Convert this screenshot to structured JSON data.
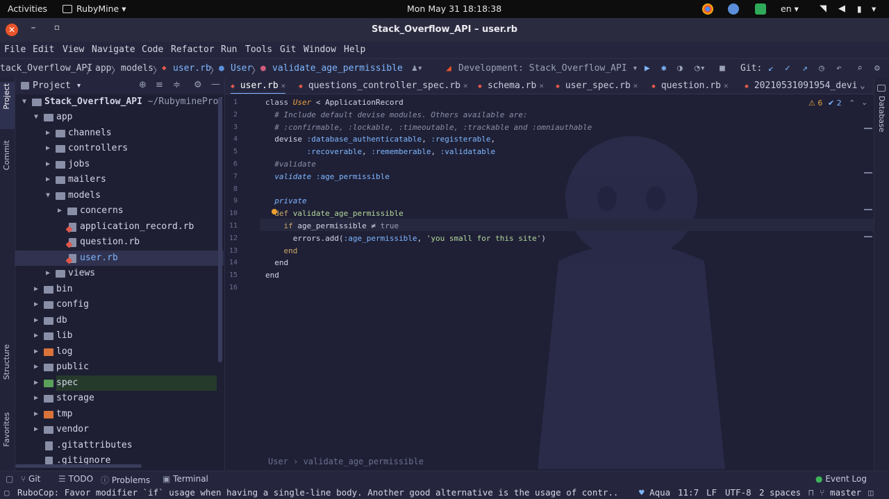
{
  "system": {
    "activities": "Activities",
    "app_menu": "RubyMine",
    "clock": "Mon May 31  18:18:38",
    "lang": "en"
  },
  "window": {
    "title": "Stack_Overflow_API – user.rb",
    "close_glyph": "✕",
    "min_glyph": "–",
    "max_glyph": "▫"
  },
  "menu": [
    "File",
    "Edit",
    "View",
    "Navigate",
    "Code",
    "Refactor",
    "Run",
    "Tools",
    "Git",
    "Window",
    "Help"
  ],
  "nav": {
    "project": "tack_Overflow_API",
    "sep": "〉",
    "app": "app",
    "models": "models",
    "file": "user.rb",
    "class": "User",
    "method": "validate_age_permissible",
    "run_config": "Development: Stack_Overflow_API",
    "git_label": "Git:"
  },
  "left_tabs": {
    "project": "Project",
    "commit": "Commit",
    "structure": "Structure",
    "favorites": "Favorites"
  },
  "right_tabs": {
    "database": "Database"
  },
  "project_panel": {
    "title": "Project",
    "root_name": "Stack_Overflow_API",
    "root_path": "~/RubymineProjec",
    "tree": [
      {
        "label": "app",
        "depth": 1,
        "open": true,
        "kind": "folder"
      },
      {
        "label": "channels",
        "depth": 2,
        "open": false,
        "kind": "folder"
      },
      {
        "label": "controllers",
        "depth": 2,
        "open": false,
        "kind": "folder"
      },
      {
        "label": "jobs",
        "depth": 2,
        "open": false,
        "kind": "folder"
      },
      {
        "label": "mailers",
        "depth": 2,
        "open": false,
        "kind": "folder"
      },
      {
        "label": "models",
        "depth": 2,
        "open": true,
        "kind": "folder"
      },
      {
        "label": "concerns",
        "depth": 3,
        "open": false,
        "kind": "folder"
      },
      {
        "label": "application_record.rb",
        "depth": 3,
        "kind": "ruby"
      },
      {
        "label": "question.rb",
        "depth": 3,
        "kind": "ruby"
      },
      {
        "label": "user.rb",
        "depth": 3,
        "kind": "ruby",
        "selected": true
      },
      {
        "label": "views",
        "depth": 2,
        "open": false,
        "kind": "folder"
      },
      {
        "label": "bin",
        "depth": 1,
        "open": false,
        "kind": "folder"
      },
      {
        "label": "config",
        "depth": 1,
        "open": false,
        "kind": "folder"
      },
      {
        "label": "db",
        "depth": 1,
        "open": false,
        "kind": "folder"
      },
      {
        "label": "lib",
        "depth": 1,
        "open": false,
        "kind": "folder"
      },
      {
        "label": "log",
        "depth": 1,
        "open": false,
        "kind": "folder-orange"
      },
      {
        "label": "public",
        "depth": 1,
        "open": false,
        "kind": "folder"
      },
      {
        "label": "spec",
        "depth": 1,
        "open": false,
        "kind": "folder-green"
      },
      {
        "label": "storage",
        "depth": 1,
        "open": false,
        "kind": "folder"
      },
      {
        "label": "tmp",
        "depth": 1,
        "open": false,
        "kind": "folder-orange"
      },
      {
        "label": "vendor",
        "depth": 1,
        "open": false,
        "kind": "folder"
      },
      {
        "label": ".gitattributes",
        "depth": 1,
        "kind": "file"
      },
      {
        "label": ".gitignore",
        "depth": 1,
        "kind": "file"
      }
    ]
  },
  "tabs": [
    {
      "label": "user.rb",
      "active": true
    },
    {
      "label": "questions_controller_spec.rb",
      "active": false
    },
    {
      "label": "schema.rb",
      "active": false
    },
    {
      "label": "user_spec.rb",
      "active": false
    },
    {
      "label": "question.rb",
      "active": false
    },
    {
      "label": "20210531091954_devi",
      "active": false
    }
  ],
  "inspections": {
    "warnings": "6",
    "weak": "2"
  },
  "code_lines": [
    [
      {
        "t": "class",
        "c": "kw2"
      },
      {
        "t": " "
      },
      {
        "t": "User",
        "c": "cls"
      },
      {
        "t": " < ApplicationRecord"
      }
    ],
    [
      {
        "t": "  # Include default devise modules. Others available are:",
        "c": "cmt"
      }
    ],
    [
      {
        "t": "  # :confirmable, :lockable, :timeoutable, :trackable and :omniauthable",
        "c": "cmt"
      }
    ],
    [
      {
        "t": "  devise "
      },
      {
        "t": ":database_authenticatable",
        "c": "sym"
      },
      {
        "t": ", "
      },
      {
        "t": ":registerable",
        "c": "sym"
      },
      {
        "t": ","
      }
    ],
    [
      {
        "t": "         "
      },
      {
        "t": ":recoverable",
        "c": "sym"
      },
      {
        "t": ", "
      },
      {
        "t": ":rememberable",
        "c": "sym"
      },
      {
        "t": ", "
      },
      {
        "t": ":validatable",
        "c": "sym"
      }
    ],
    [
      {
        "t": "  #validate",
        "c": "cmt"
      }
    ],
    [
      {
        "t": "  "
      },
      {
        "t": "validate",
        "c": "valid"
      },
      {
        "t": " "
      },
      {
        "t": ":age_permissible",
        "c": "sym"
      }
    ],
    [
      {
        "t": ""
      }
    ],
    [
      {
        "t": "  "
      },
      {
        "t": "private",
        "c": "valid"
      }
    ],
    [
      {
        "t": "  "
      },
      {
        "t": "def",
        "c": "kw"
      },
      {
        "t": " validate_age_permissible",
        "c": "str"
      }
    ],
    [
      {
        "t": "    "
      },
      {
        "t": "if",
        "c": "kw"
      },
      {
        "t": " age_permissible ≠ "
      },
      {
        "t": "true",
        "c": "muted"
      }
    ],
    [
      {
        "t": "      errors.add("
      },
      {
        "t": ":age_permissible",
        "c": "sym"
      },
      {
        "t": ", "
      },
      {
        "t": "'you small for this site'",
        "c": "str"
      },
      {
        "t": ")"
      }
    ],
    [
      {
        "t": "    "
      },
      {
        "t": "end",
        "c": "kw"
      }
    ],
    [
      {
        "t": "  end"
      }
    ],
    [
      {
        "t": "end"
      }
    ],
    [
      {
        "t": ""
      }
    ]
  ],
  "editor_breadcrumb": "User  ›  validate_age_permissible",
  "bottom_tools": [
    "Git",
    "TODO",
    "Problems",
    "Terminal"
  ],
  "event_log": "Event Log",
  "status": {
    "message": "RuboCop: Favor modifier `if` usage when having a single-line body. Another good alternative is the usage of contr..",
    "theme": "Aqua",
    "position": "11:7",
    "line_sep": "LF",
    "encoding": "UTF-8",
    "indent": "2 spaces",
    "branch": "master"
  }
}
